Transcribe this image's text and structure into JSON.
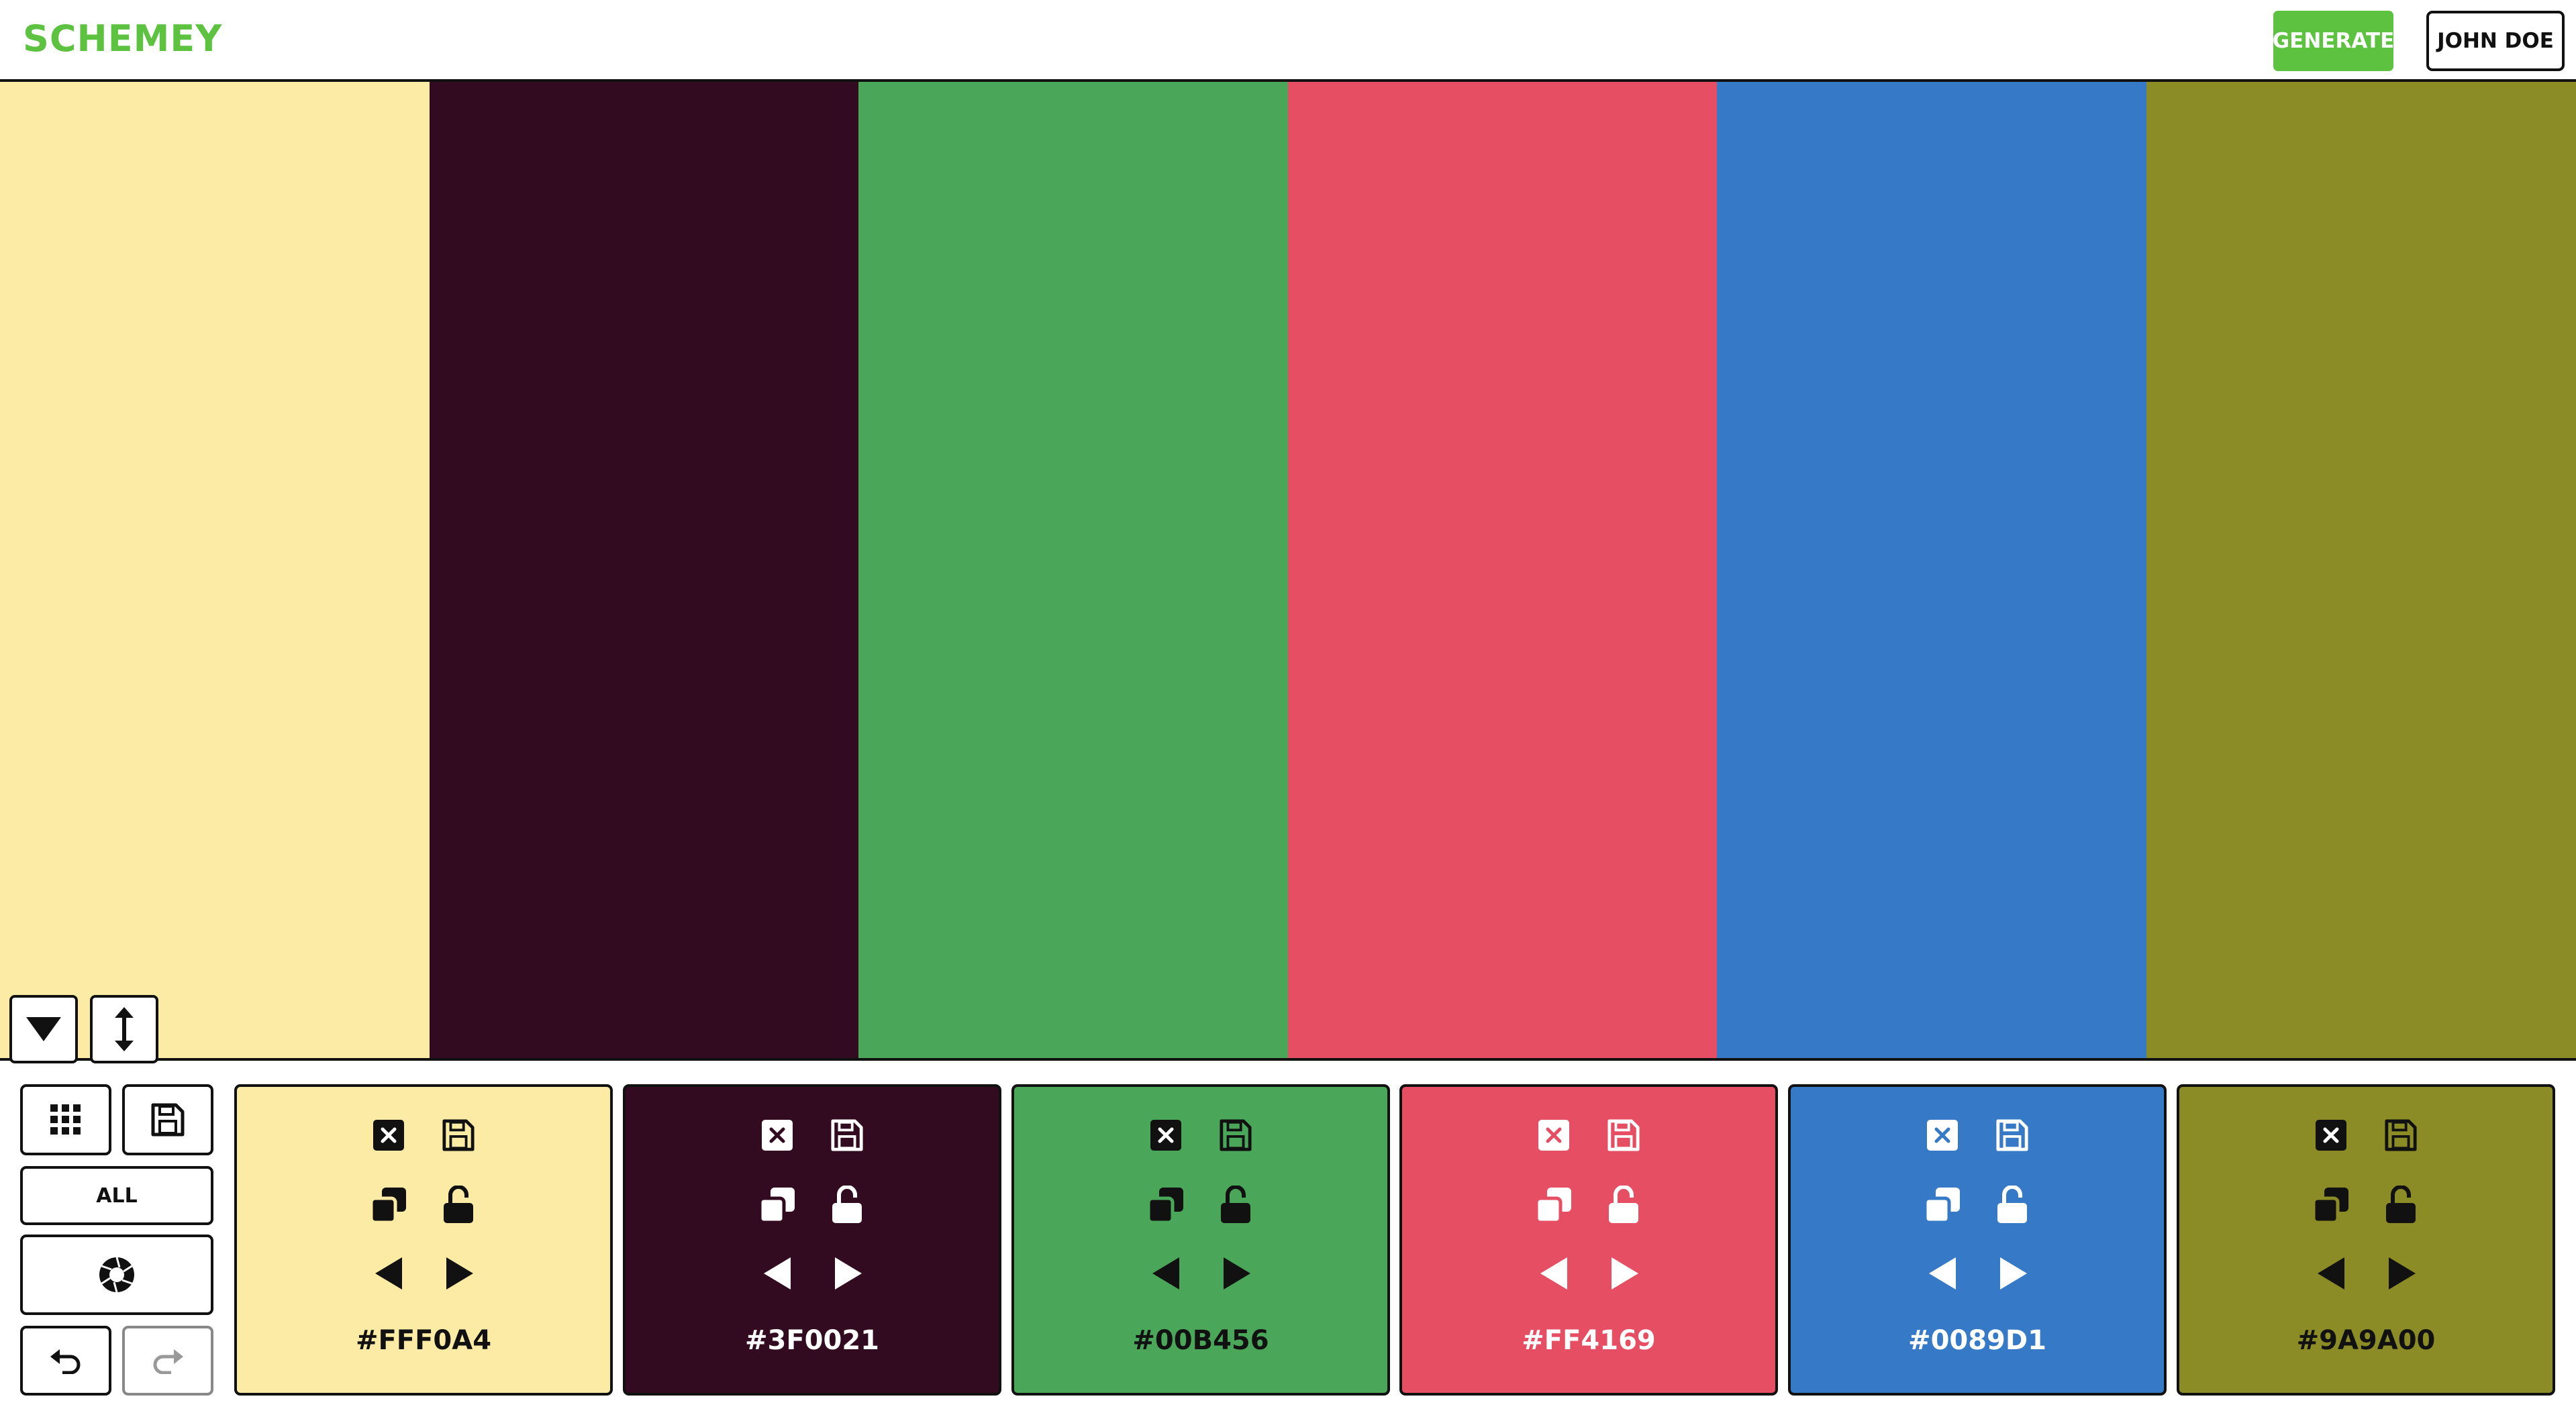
{
  "header": {
    "logo": "SCHEMEY",
    "generate_label": "GENERATE",
    "user_label": "JOHN DOE"
  },
  "colors": {
    "brand_green": "#5CC240",
    "stripes": [
      "#FBEBA4",
      "#320B20",
      "#4AA75A",
      "#E64F63",
      "#3679C6",
      "#8B8C26"
    ]
  },
  "view_controls": {
    "collapse_icon": "triangle-down-icon",
    "resize_icon": "vertical-arrows-icon"
  },
  "toolbar": {
    "grid_icon": "grid-icon",
    "save_icon": "save-icon",
    "all_label": "ALL",
    "randomize_icon": "aperture-icon",
    "undo_icon": "undo-icon",
    "redo_icon": "redo-icon"
  },
  "cards": [
    {
      "hex": "#FFF0A4",
      "bg": "#FBEBA4",
      "fg": "#111111"
    },
    {
      "hex": "#3F0021",
      "bg": "#320B20",
      "fg": "#FFFFFF"
    },
    {
      "hex": "#00B456",
      "bg": "#4AA75A",
      "fg": "#111111"
    },
    {
      "hex": "#FF4169",
      "bg": "#E64F63",
      "fg": "#FFFFFF"
    },
    {
      "hex": "#0089D1",
      "bg": "#3679C6",
      "fg": "#FFFFFF"
    },
    {
      "hex": "#9A9A00",
      "bg": "#8B8C26",
      "fg": "#111111"
    }
  ]
}
